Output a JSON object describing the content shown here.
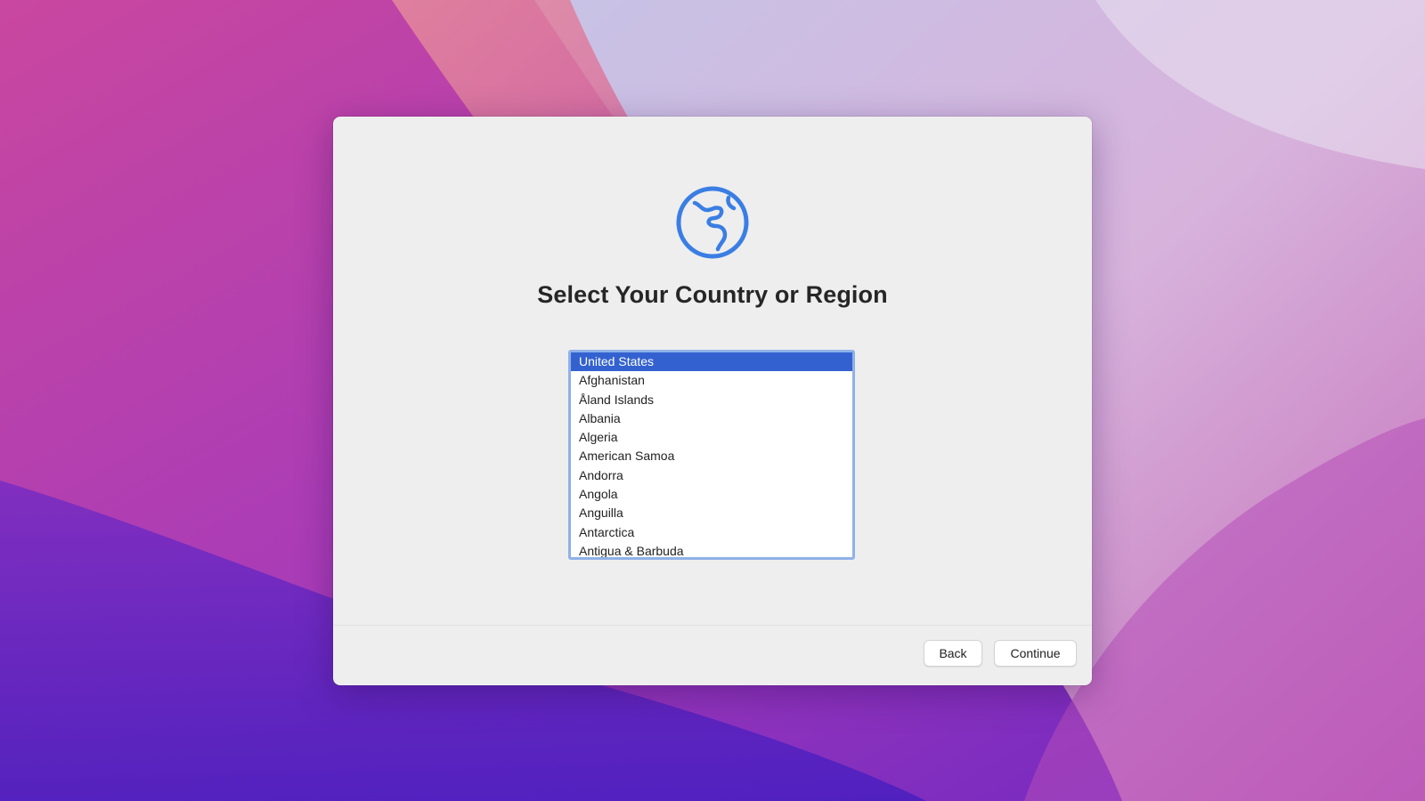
{
  "dialog": {
    "title": "Select Your Country or Region",
    "icon": "globe-icon",
    "countries": [
      "United States",
      "Afghanistan",
      "Åland Islands",
      "Albania",
      "Algeria",
      "American Samoa",
      "Andorra",
      "Angola",
      "Anguilla",
      "Antarctica",
      "Antigua & Barbuda"
    ],
    "selected_country": "United States"
  },
  "footer": {
    "back_label": "Back",
    "continue_label": "Continue"
  },
  "colors": {
    "accent": "#3362d0",
    "globe": "#3a7ee4",
    "list_border": "#8fb1e8",
    "dialog_bg": "#eeeeee"
  }
}
